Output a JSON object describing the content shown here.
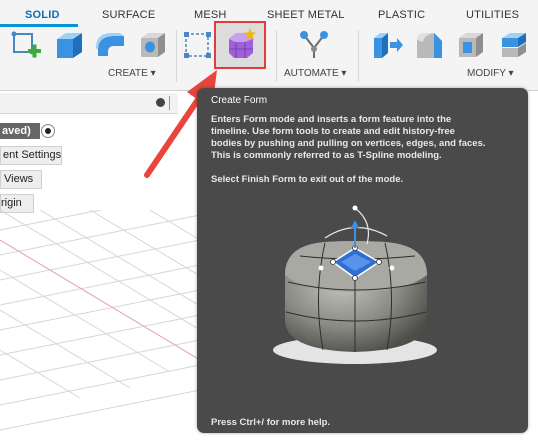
{
  "ribbon": {
    "tabs": [
      {
        "label": "SOLID"
      },
      {
        "label": "SURFACE"
      },
      {
        "label": "MESH"
      },
      {
        "label": "SHEET METAL"
      },
      {
        "label": "PLASTIC"
      },
      {
        "label": "UTILITIES"
      }
    ],
    "groups": {
      "create": "CREATE ▾",
      "automate": "AUTOMATE ▾",
      "modify": "MODIFY ▾"
    }
  },
  "browser": {
    "unsaved_label": "aved)",
    "items": [
      "ent Settings",
      "Views",
      "rigin"
    ]
  },
  "tooltip": {
    "title": "Create Form",
    "lines": [
      "Enters Form mode and inserts a form feature into the",
      "timeline. Use form tools to create and edit history-free",
      "bodies by pushing and pulling on vertices, edges, and faces.",
      "This is commonly referred to as T-Spline modeling.",
      "Select Finish Form to exit out of the mode."
    ],
    "help": "Press Ctrl+/ for more help."
  },
  "colors": {
    "accent": "#0696d7",
    "highlight_box": "#e23b3b",
    "arrow": "#e8453c",
    "tooltip_bg": "#4a4a4a"
  },
  "icons": [
    "create-sketch-icon",
    "extrude-box-icon",
    "revolve-icon",
    "hole-icon",
    "rectangular-pattern-icon",
    "create-form-icon",
    "automate-icon",
    "press-pull-icon",
    "fillet-icon",
    "shell-icon",
    "combine-icon",
    "settings-icon"
  ]
}
